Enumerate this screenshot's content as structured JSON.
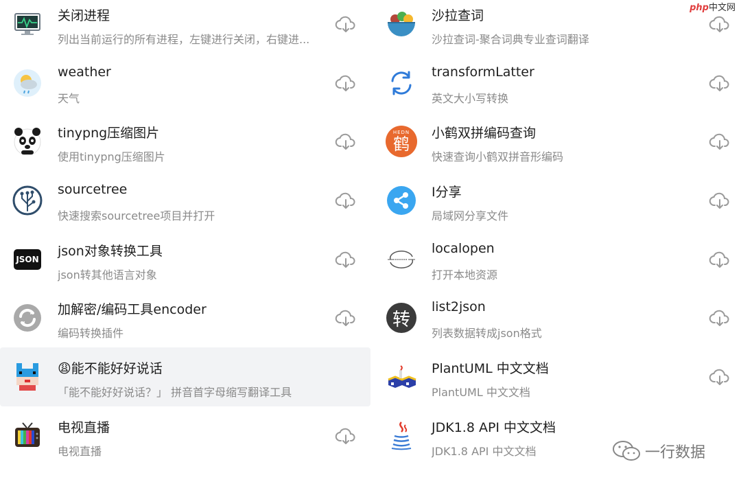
{
  "watermarks": {
    "top_logo": "php",
    "top_text": "中文网",
    "bottom_text": "一行数据"
  },
  "plugins": {
    "left": [
      {
        "icon": "activity-monitor-icon",
        "title": "关闭进程",
        "desc": "列出当前运行的所有进程，左键进行关闭，右键进..."
      },
      {
        "icon": "weather-icon",
        "title": "weather",
        "desc": "天气"
      },
      {
        "icon": "panda-icon",
        "title": "tinypng压缩图片",
        "desc": "使用tinypng压缩图片"
      },
      {
        "icon": "sourcetree-icon",
        "title": "sourcetree",
        "desc": "快速搜索sourcetree项目并打开"
      },
      {
        "icon": "json-icon",
        "title": "json对象转换工具",
        "desc": "json转其他语言对象"
      },
      {
        "icon": "convert-icon",
        "title": "加解密/编码工具encoder",
        "desc": "编码转换插件"
      },
      {
        "icon": "pixel-face-icon",
        "title": "😩能不能好好说话",
        "desc": "「能不能好好说话？」 拼音首字母缩写翻译工具"
      },
      {
        "icon": "tv-icon",
        "title": "电视直播",
        "desc": "电视直播"
      }
    ],
    "right": [
      {
        "icon": "salad-icon",
        "title": "沙拉查词",
        "desc": "沙拉查词-聚合词典专业查词翻译"
      },
      {
        "icon": "refresh-icon",
        "title": "transformLatter",
        "desc": "英文大小写转换"
      },
      {
        "icon": "heron-icon",
        "title": "小鹤双拼编码查询",
        "desc": "快速查询小鹤双拼音形编码"
      },
      {
        "icon": "share-icon",
        "title": "I分享",
        "desc": "局域网分享文件"
      },
      {
        "icon": "localopen-icon",
        "title": "localopen",
        "desc": "打开本地资源"
      },
      {
        "icon": "zhuan-icon",
        "title": "list2json",
        "desc": "列表数据转成json格式"
      },
      {
        "icon": "plantuml-icon",
        "title": "PlantUML 中文文档",
        "desc": "PlantUML 中文文档"
      },
      {
        "icon": "java-icon",
        "title": "JDK1.8 API 中文文档",
        "desc": "JDK1.8 API 中文文档"
      }
    ]
  },
  "icon_text": {
    "json_badge": "JSON",
    "heron_char": "鹤",
    "heron_top": "HEDN",
    "zhuan_char": "转"
  },
  "colors": {
    "title": "#1f1f1f",
    "desc": "#8a8a8a",
    "highlight_row": "#f2f3f5",
    "download_icon": "#9a9a9a"
  }
}
